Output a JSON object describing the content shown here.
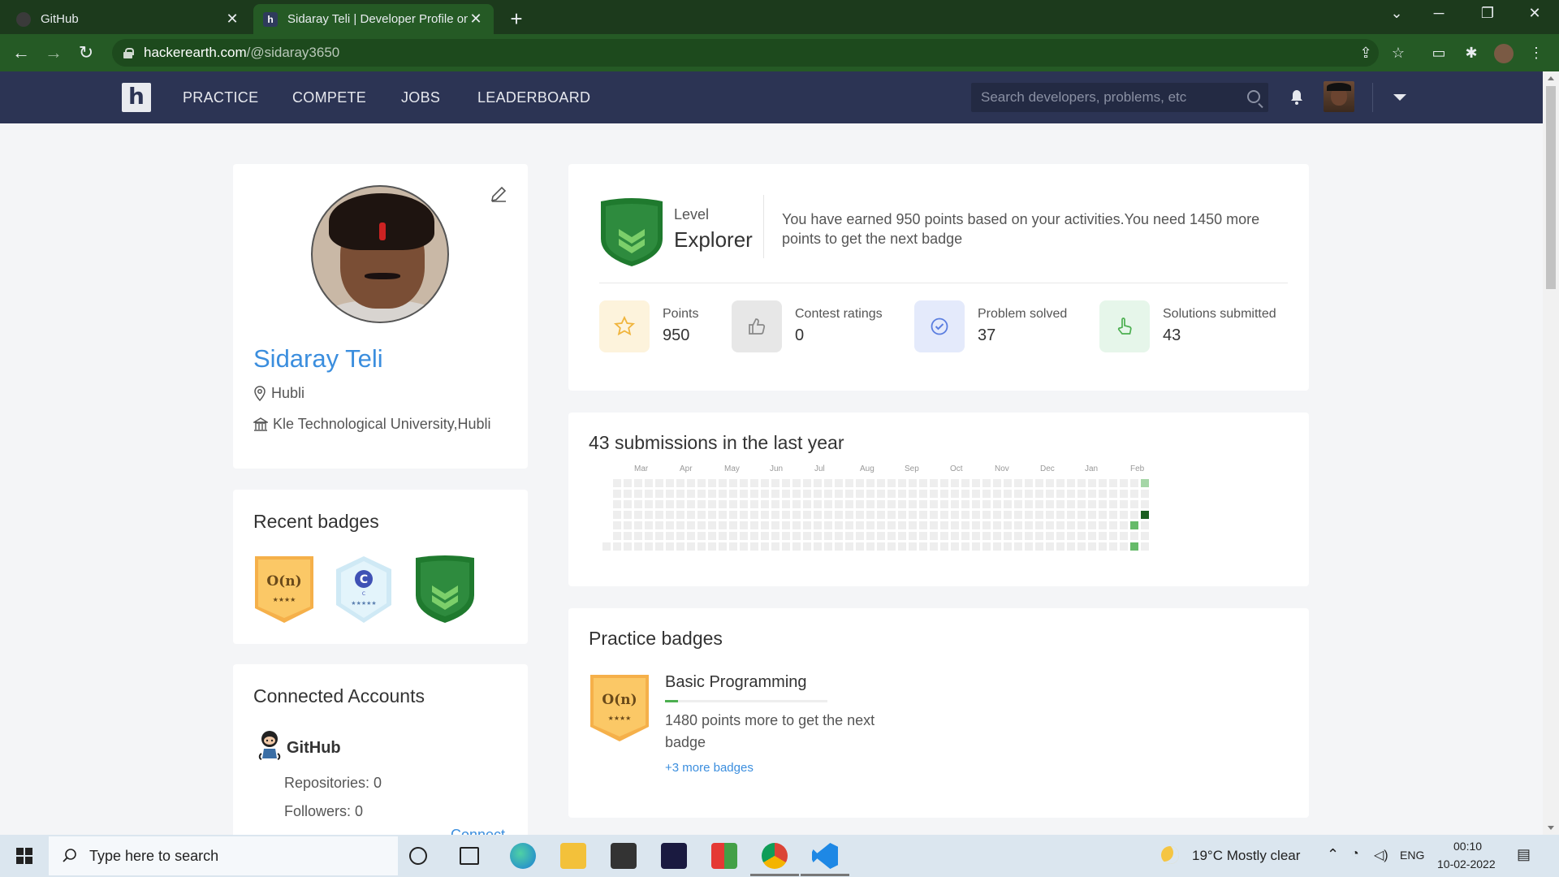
{
  "browser": {
    "tabs": [
      {
        "title": "GitHub"
      },
      {
        "title": "Sidaray Teli | Developer Profile on"
      }
    ],
    "url_domain": "hackerearth.com",
    "url_path": "/@sidaray3650"
  },
  "header": {
    "logo": "h",
    "nav": [
      "PRACTICE",
      "COMPETE",
      "JOBS",
      "LEADERBOARD"
    ],
    "search_placeholder": "Search developers, problems, etc"
  },
  "profile": {
    "name": "Sidaray Teli",
    "location": "Hubli",
    "institution": "Kle Technological University,Hubli"
  },
  "recent_badges": {
    "title": "Recent badges",
    "items": [
      {
        "label": "O(n)",
        "stars": "★★★★",
        "color": "#f7b955",
        "name": "basic-programming"
      },
      {
        "label": "C",
        "stars": "★★★★★",
        "sub": "C",
        "color": "#d6eef8",
        "name": "c-language"
      },
      {
        "label": "",
        "color": "#2e8b3e",
        "name": "explorer-level"
      }
    ]
  },
  "connected": {
    "title": "Connected Accounts",
    "account": "GitHub",
    "repositories": "Repositories: 0",
    "followers": "Followers: 0",
    "connect": "Connect"
  },
  "level": {
    "label": "Level",
    "value": "Explorer",
    "message": "You have earned 950 points based on your activities.You need 1450 more points to get the next badge",
    "stats": [
      {
        "label": "Points",
        "value": "950",
        "icon": "star-icon",
        "bg": "#fdf3dc"
      },
      {
        "label": "Contest ratings",
        "value": "0",
        "icon": "thumbs-up-icon",
        "bg": "#e7e7e7"
      },
      {
        "label": "Problem solved",
        "value": "37",
        "icon": "check-circle-icon",
        "bg": "#e4eafb"
      },
      {
        "label": "Solutions submitted",
        "value": "43",
        "icon": "pointer-icon",
        "bg": "#e6f6ea"
      }
    ]
  },
  "activity": {
    "title": "43 submissions in the last year",
    "months": [
      "Mar",
      "Apr",
      "May",
      "Jun",
      "Jul",
      "Aug",
      "Sep",
      "Oct",
      "Nov",
      "Dec",
      "Jan",
      "Feb"
    ],
    "highlights": [
      {
        "week": 51,
        "day": 0,
        "level": 1
      },
      {
        "week": 51,
        "day": 3,
        "level": 3
      },
      {
        "week": 50,
        "day": 4,
        "level": 2
      },
      {
        "week": 50,
        "day": 6,
        "level": 2
      }
    ]
  },
  "practice": {
    "title": "Practice badges",
    "badge_name": "Basic Programming",
    "badge_label": "O(n)",
    "badge_stars": "★★★★",
    "progress": 0.08,
    "message": "1480 points more to get the next badge",
    "more": "+3 more badges"
  },
  "taskbar": {
    "search_placeholder": "Type here to search",
    "weather": "19°C  Mostly clear",
    "lang": "ENG",
    "time": "00:10",
    "date": "10-02-2022"
  },
  "colors": {
    "brand_blue": "#3b8ede",
    "header_bg": "#2c3454",
    "chrome_green": "#255a25"
  }
}
